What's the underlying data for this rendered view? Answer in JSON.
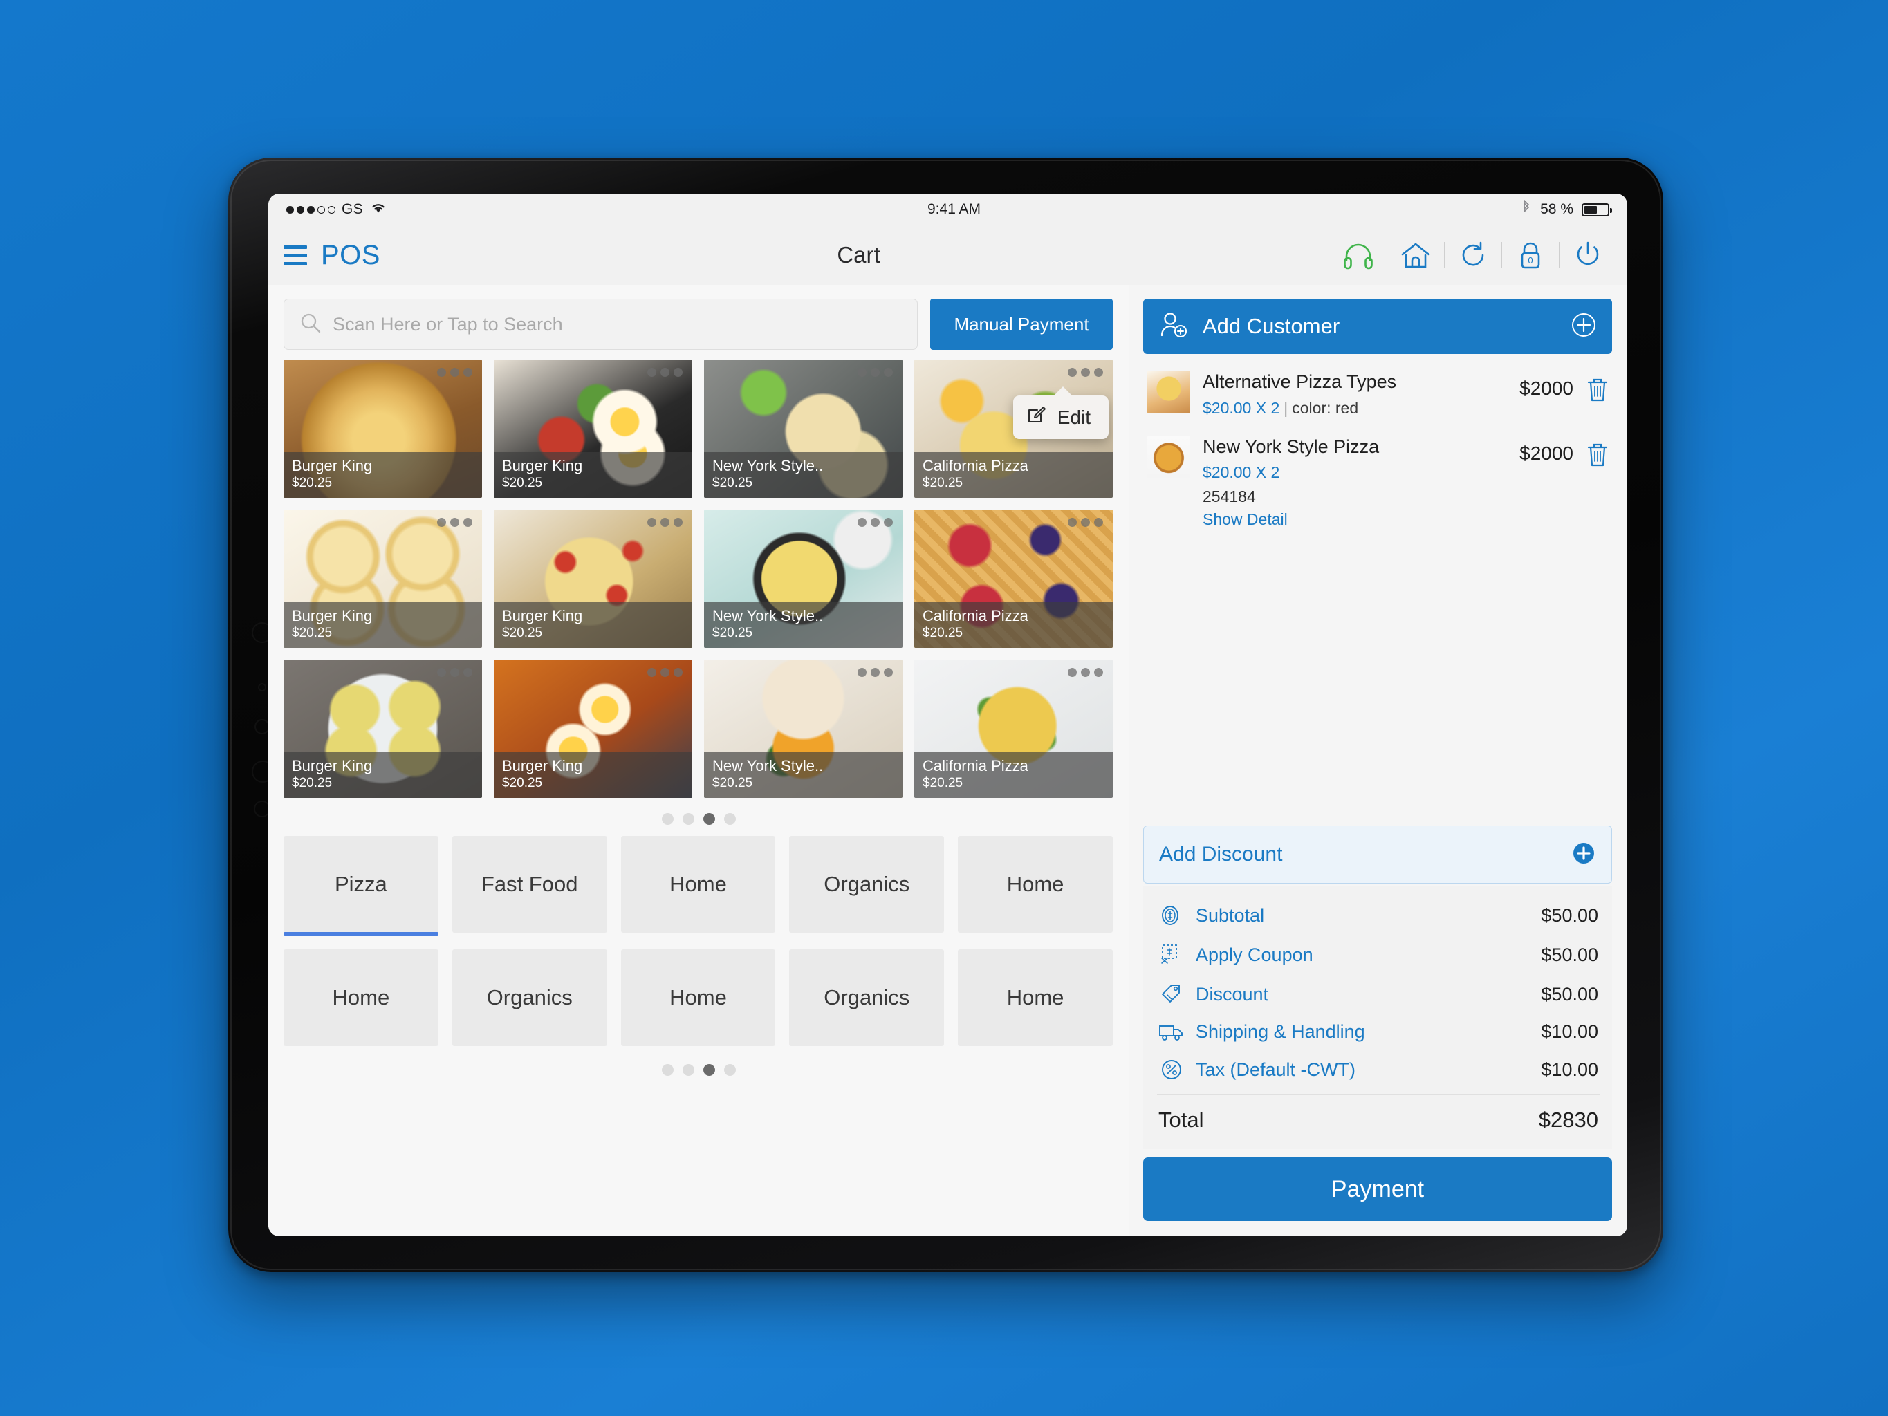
{
  "status_bar": {
    "carrier": "GS",
    "signal_dots_filled": 3,
    "signal_dots_total": 5,
    "wifi_icon": "wifi-icon",
    "time": "9:41 AM",
    "bluetooth_icon": "bluetooth-icon",
    "battery_percent": "58 %",
    "battery_level": 55
  },
  "header": {
    "menu_icon": "hamburger-menu-icon",
    "brand": "POS",
    "title": "Cart",
    "icons": [
      {
        "name": "headphones-icon",
        "color": "#3fb44a"
      },
      {
        "name": "home-icon",
        "color": "#1a7ac4"
      },
      {
        "name": "refresh-icon",
        "color": "#1a7ac4"
      },
      {
        "name": "lock-icon",
        "color": "#1a7ac4",
        "badge": "0"
      },
      {
        "name": "power-icon",
        "color": "#1a7ac4"
      }
    ]
  },
  "search": {
    "placeholder": "Scan Here or Tap to Search",
    "value": "",
    "icon": "search-icon"
  },
  "manual_payment_label": "Manual Payment",
  "products": [
    {
      "name": "Burger King",
      "price": "$20.25",
      "photo": "breakfast-wrap-stack"
    },
    {
      "name": "Burger King",
      "price": "$20.25",
      "photo": "skillet-eggs-avocado"
    },
    {
      "name": "New York Style..",
      "price": "$20.25",
      "photo": "breakfast-tacos"
    },
    {
      "name": "California Pizza",
      "price": "$20.25",
      "photo": "pizza-slices-plate",
      "edit_popup": {
        "label": "Edit",
        "icon": "edit-pencil-icon"
      }
    },
    {
      "name": "Burger King",
      "price": "$20.25",
      "photo": "pinwheel-rolls"
    },
    {
      "name": "Burger King",
      "price": "$20.25",
      "photo": "baked-casserole-tomato"
    },
    {
      "name": "New York Style..",
      "price": "$20.25",
      "photo": "frittata-skillet"
    },
    {
      "name": "California Pizza",
      "price": "$20.25",
      "photo": "berry-waffles"
    },
    {
      "name": "Burger King",
      "price": "$20.25",
      "photo": "mini-frittatas-plate"
    },
    {
      "name": "Burger King",
      "price": "$20.25",
      "photo": "shakshuka-skillet"
    },
    {
      "name": "New York Style..",
      "price": "$20.25",
      "photo": "egg-biscuit-sandwich"
    },
    {
      "name": "California Pizza",
      "price": "$20.25",
      "photo": "scrambled-eggs-herbs"
    }
  ],
  "product_pager": {
    "total": 4,
    "active": 3
  },
  "categories_row1": [
    {
      "label": "Pizza",
      "active": true
    },
    {
      "label": "Fast Food",
      "active": false
    },
    {
      "label": "Home",
      "active": false
    },
    {
      "label": "Organics",
      "active": false
    },
    {
      "label": "Home",
      "active": false
    }
  ],
  "categories_row2": [
    {
      "label": "Home",
      "active": false
    },
    {
      "label": "Organics",
      "active": false
    },
    {
      "label": "Home",
      "active": false
    },
    {
      "label": "Organics",
      "active": false
    },
    {
      "label": "Home",
      "active": false
    }
  ],
  "category_pager": {
    "total": 4,
    "active": 3
  },
  "cart": {
    "add_customer": {
      "label": "Add Customer",
      "icon": "add-user-icon",
      "plus_icon": "plus-circle-icon"
    },
    "items": [
      {
        "name": "Alternative Pizza Types",
        "unit_price": "$20.00",
        "qty_separator": "X",
        "qty": "2",
        "attribute": "color: red",
        "sku": "",
        "show_detail": "",
        "line_total": "$2000",
        "thumb": "pizza-slice-thumb",
        "delete_icon": "trash-icon"
      },
      {
        "name": "New York Style Pizza",
        "unit_price": "$20.00",
        "qty_separator": "X",
        "qty": "2",
        "attribute": "",
        "sku": "254184",
        "show_detail": "Show Detail",
        "line_total": "$2000",
        "thumb": "whole-pizza-thumb",
        "delete_icon": "trash-icon"
      }
    ],
    "add_discount": {
      "label": "Add Discount",
      "plus_icon": "plus-circle-filled-icon"
    },
    "totals": [
      {
        "label": "Subtotal",
        "value": "$50.00",
        "icon": "coin-dollar-icon"
      },
      {
        "label": "Apply Coupon",
        "value": "$50.00",
        "icon": "coupon-icon"
      },
      {
        "label": "Discount",
        "value": "$50.00",
        "icon": "price-tag-icon"
      },
      {
        "label": "Shipping & Handling",
        "value": "$10.00",
        "icon": "truck-icon"
      },
      {
        "label": "Tax (Default -CWT)",
        "value": "$10.00",
        "icon": "percent-icon"
      }
    ],
    "total": {
      "label": "Total",
      "value": "$2830"
    },
    "payment_label": "Payment"
  },
  "colors": {
    "accent": "#1a7ac4",
    "accent_green": "#3fb44a",
    "page_bg": "#f5f5f5",
    "tile_caption": "rgba(60,60,60,.66)",
    "category_bg": "#eaeaea",
    "active_underline": "#4a7fe0"
  }
}
